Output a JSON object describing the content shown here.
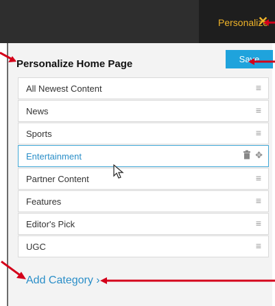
{
  "header": {
    "personalize_label": "Personalize",
    "close_glyph": "✕"
  },
  "panel": {
    "title": "Personalize Home Page",
    "save_label": "Save",
    "add_category_label": "Add Category",
    "add_category_chevron": "›"
  },
  "categories": [
    {
      "label": "All Newest Content",
      "active": false
    },
    {
      "label": "News",
      "active": false
    },
    {
      "label": "Sports",
      "active": false
    },
    {
      "label": "Entertainment",
      "active": true
    },
    {
      "label": "Partner Content",
      "active": false
    },
    {
      "label": "Features",
      "active": false
    },
    {
      "label": "Editor's Pick",
      "active": false
    },
    {
      "label": "UGC",
      "active": false
    }
  ],
  "icons": {
    "drag_handle": "≡",
    "trash": "🗑",
    "move": "✥"
  },
  "colors": {
    "accent": "#f0b429",
    "primary": "#1fa3dc",
    "annotation": "#d4001a"
  }
}
